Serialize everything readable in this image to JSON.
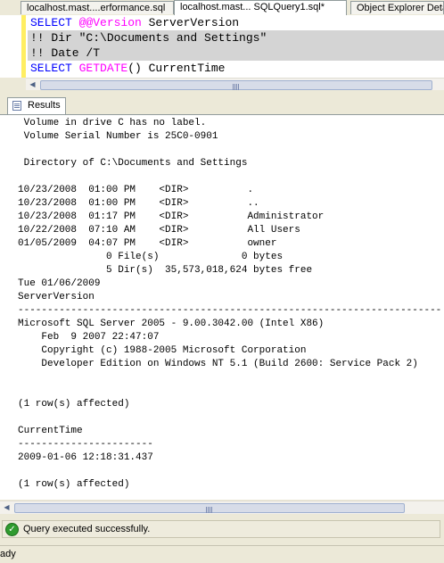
{
  "tabs": [
    {
      "label": "localhost.mast....erformance.sql",
      "active": false
    },
    {
      "label": "localhost.mast... SQLQuery1.sql*",
      "active": true
    },
    {
      "label": "Object Explorer Deta",
      "active": false
    }
  ],
  "editor": {
    "lines": [
      {
        "parts": [
          {
            "t": "SELECT ",
            "c": "kw"
          },
          {
            "t": "@@Version",
            "c": "var"
          },
          {
            "t": " ServerVersion",
            "c": "plain"
          }
        ],
        "selected": false
      },
      {
        "parts": [
          {
            "t": "!! Dir \"C:\\Documents and Settings\"",
            "c": "plain"
          }
        ],
        "selected": true
      },
      {
        "parts": [
          {
            "t": "!! Date /T",
            "c": "plain"
          }
        ],
        "selected": true
      },
      {
        "parts": [
          {
            "t": "SELECT ",
            "c": "kw"
          },
          {
            "t": "GETDATE",
            "c": "fn"
          },
          {
            "t": "()",
            "c": "plain"
          },
          {
            "t": " CurrentTime",
            "c": "plain"
          }
        ],
        "selected": false
      }
    ]
  },
  "results_tab": {
    "label": "Results"
  },
  "results": {
    "lines": [
      " Volume in drive C has no label.",
      " Volume Serial Number is 25C0-0901",
      "",
      " Directory of C:\\Documents and Settings",
      "",
      "10/23/2008  01:00 PM    <DIR>          .",
      "10/23/2008  01:00 PM    <DIR>          ..",
      "10/23/2008  01:17 PM    <DIR>          Administrator",
      "10/22/2008  07:10 AM    <DIR>          All Users",
      "01/05/2009  04:07 PM    <DIR>          owner",
      "               0 File(s)              0 bytes",
      "               5 Dir(s)  35,573,018,624 bytes free",
      "Tue 01/06/2009",
      "ServerVersion",
      "------------------------------------------------------------------------",
      "Microsoft SQL Server 2005 - 9.00.3042.00 (Intel X86)",
      "    Feb  9 2007 22:47:07",
      "    Copyright (c) 1988-2005 Microsoft Corporation",
      "    Developer Edition on Windows NT 5.1 (Build 2600: Service Pack 2)",
      "",
      "",
      "(1 row(s) affected)",
      "",
      "CurrentTime",
      "-----------------------",
      "2009-01-06 12:18:31.437",
      "",
      "(1 row(s) affected)"
    ]
  },
  "status_message": "Query executed successfully.",
  "app_status": "ady"
}
